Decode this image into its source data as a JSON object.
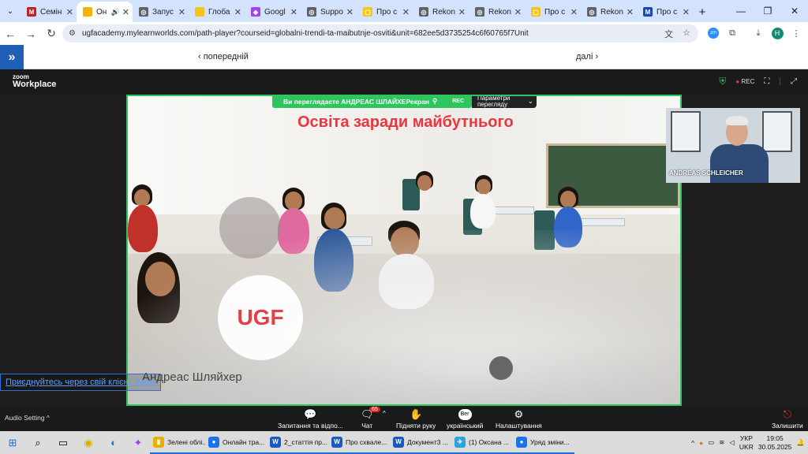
{
  "browser": {
    "tabs": [
      {
        "label": "Семін",
        "fav_color": "#c5221f",
        "fav": "M"
      },
      {
        "label": "Он",
        "fav_color": "#f5b400",
        "fav": "",
        "active": true,
        "audio": "🔊"
      },
      {
        "label": "Запус",
        "fav_color": "#5f6368",
        "fav": "◎"
      },
      {
        "label": "Глоба",
        "fav_color": "#f5c518",
        "fav": ""
      },
      {
        "label": "Googl",
        "fav_color": "#a142f4",
        "fav": "◆"
      },
      {
        "label": "Suppo",
        "fav_color": "#5f6368",
        "fav": "◎"
      },
      {
        "label": "Про с",
        "fav_color": "#f5c518",
        "fav": "▢"
      },
      {
        "label": "Rekon",
        "fav_color": "#5f6368",
        "fav": "◎"
      },
      {
        "label": "Rekon",
        "fav_color": "#5f6368",
        "fav": "◎"
      },
      {
        "label": "Про с",
        "fav_color": "#f5c518",
        "fav": "▢"
      },
      {
        "label": "Rekon",
        "fav_color": "#5f6368",
        "fav": "◎"
      },
      {
        "label": "Про с",
        "fav_color": "#1a47b8",
        "fav": "M"
      }
    ],
    "url": "ugfacademy.mylearnworlds.com/path-player?courseid=globalni-trendi-ta-maibutnje-osviti&unit=682ee5d3735254c6f60765f7Unit",
    "profile_initial": "H"
  },
  "learn_panel": {
    "prev_label": "‹ попередній",
    "next_label": "далі ›"
  },
  "zoom": {
    "brand_top": "zoom",
    "brand_bottom": "Workplace",
    "rec_label": "REC",
    "share_notice": "Ви переглядаєте АНДРЕАС ШЛАЙХЕРекран",
    "share_rec": "REC",
    "view_options": "Параметри перегляду",
    "slide_title": "Освіта заради майбутнього",
    "slide_logo": "UGF",
    "speaker_name": "Андреас Шляйхер",
    "video_name": "ANDREAS SCHLEICHER",
    "join_link": "Приєднуйтесь через свій клієнт Zoom",
    "audio_setting": "Audio Setting ^",
    "controls": {
      "qa": "Запитання та відпо...",
      "chat": "Чат",
      "chat_badge": "65",
      "raise_hand": "Підняти руку",
      "language": "український",
      "language_chip": "Вег",
      "settings": "Налаштування",
      "leave": "Залишити"
    }
  },
  "taskbar": {
    "apps": [
      {
        "label": "Зелені облі...",
        "color": "#e8b100",
        "icon": "▮"
      },
      {
        "label": "Онлайн тра...",
        "color": "#1a73e8",
        "icon": "●"
      },
      {
        "label": "2_статтія пр...",
        "color": "#185abd",
        "icon": "W"
      },
      {
        "label": "Про схвале...",
        "color": "#185abd",
        "icon": "W"
      },
      {
        "label": "Документ3 ...",
        "color": "#185abd",
        "icon": "W"
      },
      {
        "label": "(1) Оксана ...",
        "color": "#2aa3e0",
        "icon": "✈"
      },
      {
        "label": "Уряд зміни...",
        "color": "#1a73e8",
        "icon": "●"
      }
    ],
    "lang_top": "УКР",
    "lang_bottom": "UKR",
    "time": "19:05",
    "date": "30.05.2025"
  }
}
